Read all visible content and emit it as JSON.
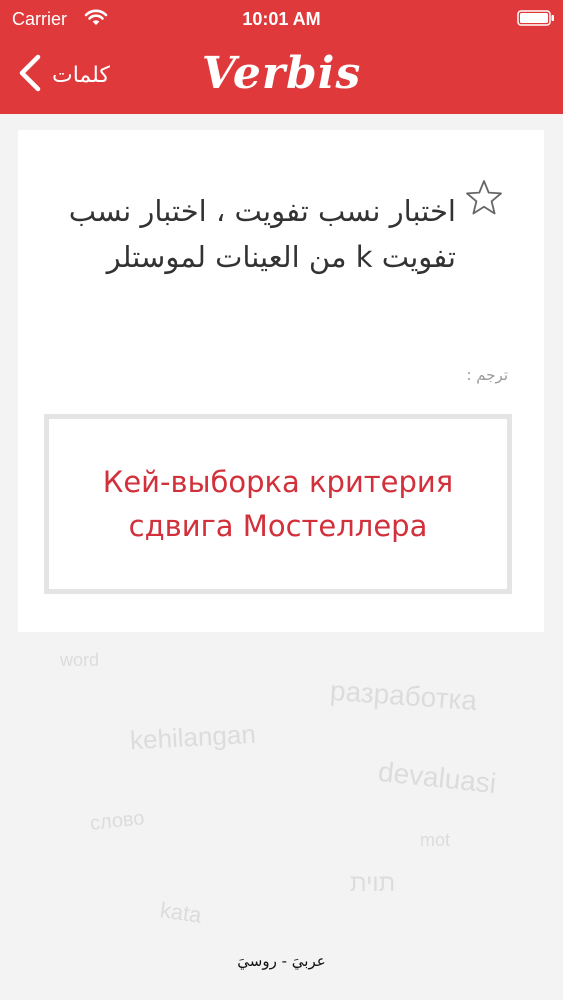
{
  "status_bar": {
    "carrier": "Carrier",
    "time": "10:01 AM"
  },
  "nav": {
    "back_label": "كلمات",
    "title": "Verbis"
  },
  "card": {
    "source_text": "اختبار نسب تفويت ، اختبار نسب تفويت k من العينات لموستلر",
    "translate_label": "ترجم :",
    "translation": "Кей-выборка критерия сдвига Мостеллера"
  },
  "footer": {
    "language_pair": "عربيَ - روسيَ"
  },
  "background_words": [
    "разработка",
    "kehilangan",
    "devaluasi",
    "תוית",
    "word",
    "слово",
    "kata",
    "mot"
  ],
  "colors": {
    "brand_red": "#e0393b",
    "translation_red": "#d2303a",
    "background": "#f3f3f3"
  }
}
